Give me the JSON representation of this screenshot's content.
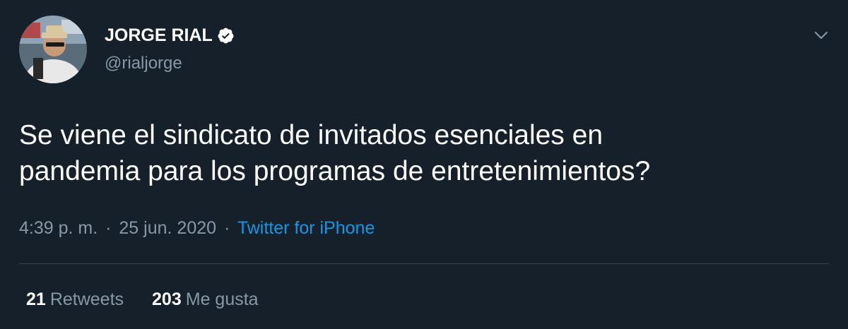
{
  "author": {
    "name": "JORGE RIAL",
    "handle": "@rialjorge",
    "verified": true
  },
  "tweet": {
    "text": "Se viene el sindicato de invitados esenciales en\npandemia para los programas de entretenimientos?",
    "time": "4:39 p. m.",
    "separator": "·",
    "date": "25 jun. 2020",
    "source": "Twitter for iPhone"
  },
  "stats": {
    "retweets_count": "21",
    "retweets_label": "Retweets",
    "likes_count": "203",
    "likes_label": "Me gusta"
  },
  "colors": {
    "background": "#15202b",
    "primary_text": "#ffffff",
    "secondary_text": "#8899a6",
    "link": "#1b95e0",
    "divider": "#38444d"
  },
  "icons": {
    "verified": "verified-badge-icon",
    "caret": "chevron-down-icon"
  }
}
